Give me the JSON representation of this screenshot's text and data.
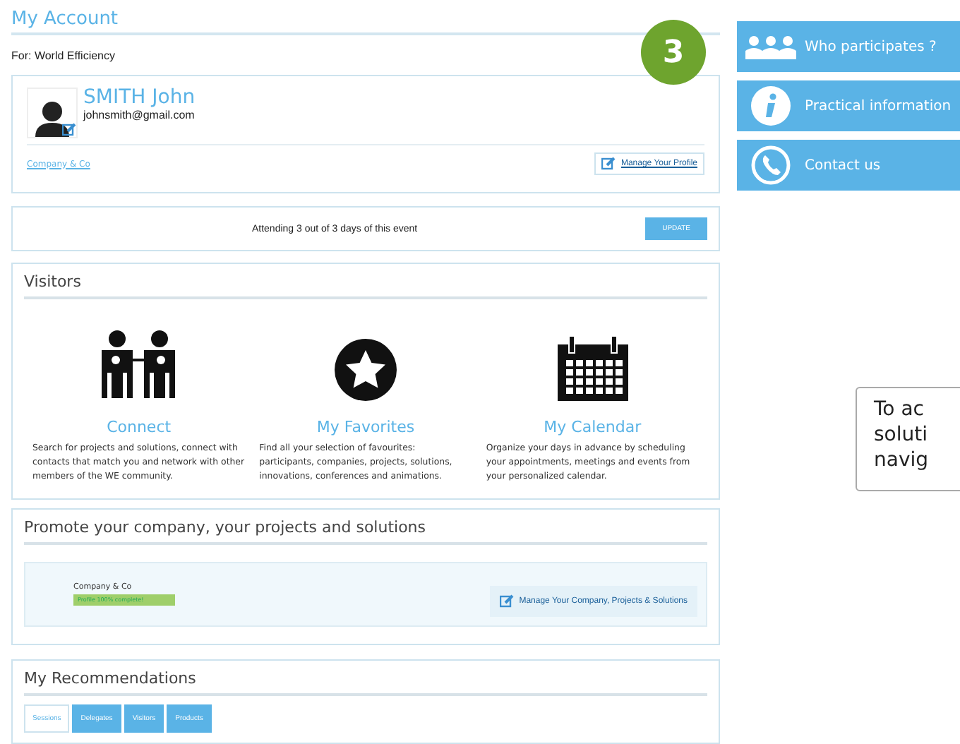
{
  "page_title": "My Account",
  "event": "For: World Efficiency",
  "callout": {
    "number": "3"
  },
  "profile": {
    "name": "SMITH John",
    "email": "johnsmith@gmail.com",
    "company_link": "Company & Co",
    "manage_button": "Manage Your Profile"
  },
  "attendance": {
    "text": "Attending 3 out of 3 days of this event",
    "button": "UPDATE"
  },
  "visitors": {
    "title": "Visitors",
    "features": [
      {
        "kind": "connect",
        "title": "Connect",
        "description": "Search for projects and solutions, connect with contacts that match you and network with other members of the WE community."
      },
      {
        "kind": "favorites",
        "title": "My Favorites",
        "description": "Find all your selection of favourites: participants, companies, projects, solutions, innovations, conferences and animations."
      },
      {
        "kind": "calendar",
        "title": "My Calendar",
        "description": "Organize your days in advance by scheduling your appointments, meetings and events from your personalized calendar."
      }
    ]
  },
  "promote": {
    "title": "Promote your company, your projects and solutions",
    "company": "Company & Co",
    "progress": {
      "label": "Profile 100% complete!",
      "level": 1
    },
    "manage_button": "Manage Your Company, Projects & Solutions"
  },
  "recommendations": {
    "title": "My Recommendations",
    "tabs": [
      {
        "label": "Sessions",
        "selected": true
      },
      {
        "label": "Delegates",
        "selected": false
      },
      {
        "label": "Visitors",
        "selected": false
      },
      {
        "label": "Products",
        "selected": false
      }
    ]
  },
  "sidebar": {
    "items": [
      {
        "kind": "participants",
        "label": "Who participates ?"
      },
      {
        "kind": "info",
        "label": "Practical information"
      },
      {
        "kind": "contact",
        "label": "Contact us"
      }
    ]
  },
  "tooltip": {
    "lines": [
      "To ac",
      "soluti",
      "navig"
    ]
  }
}
